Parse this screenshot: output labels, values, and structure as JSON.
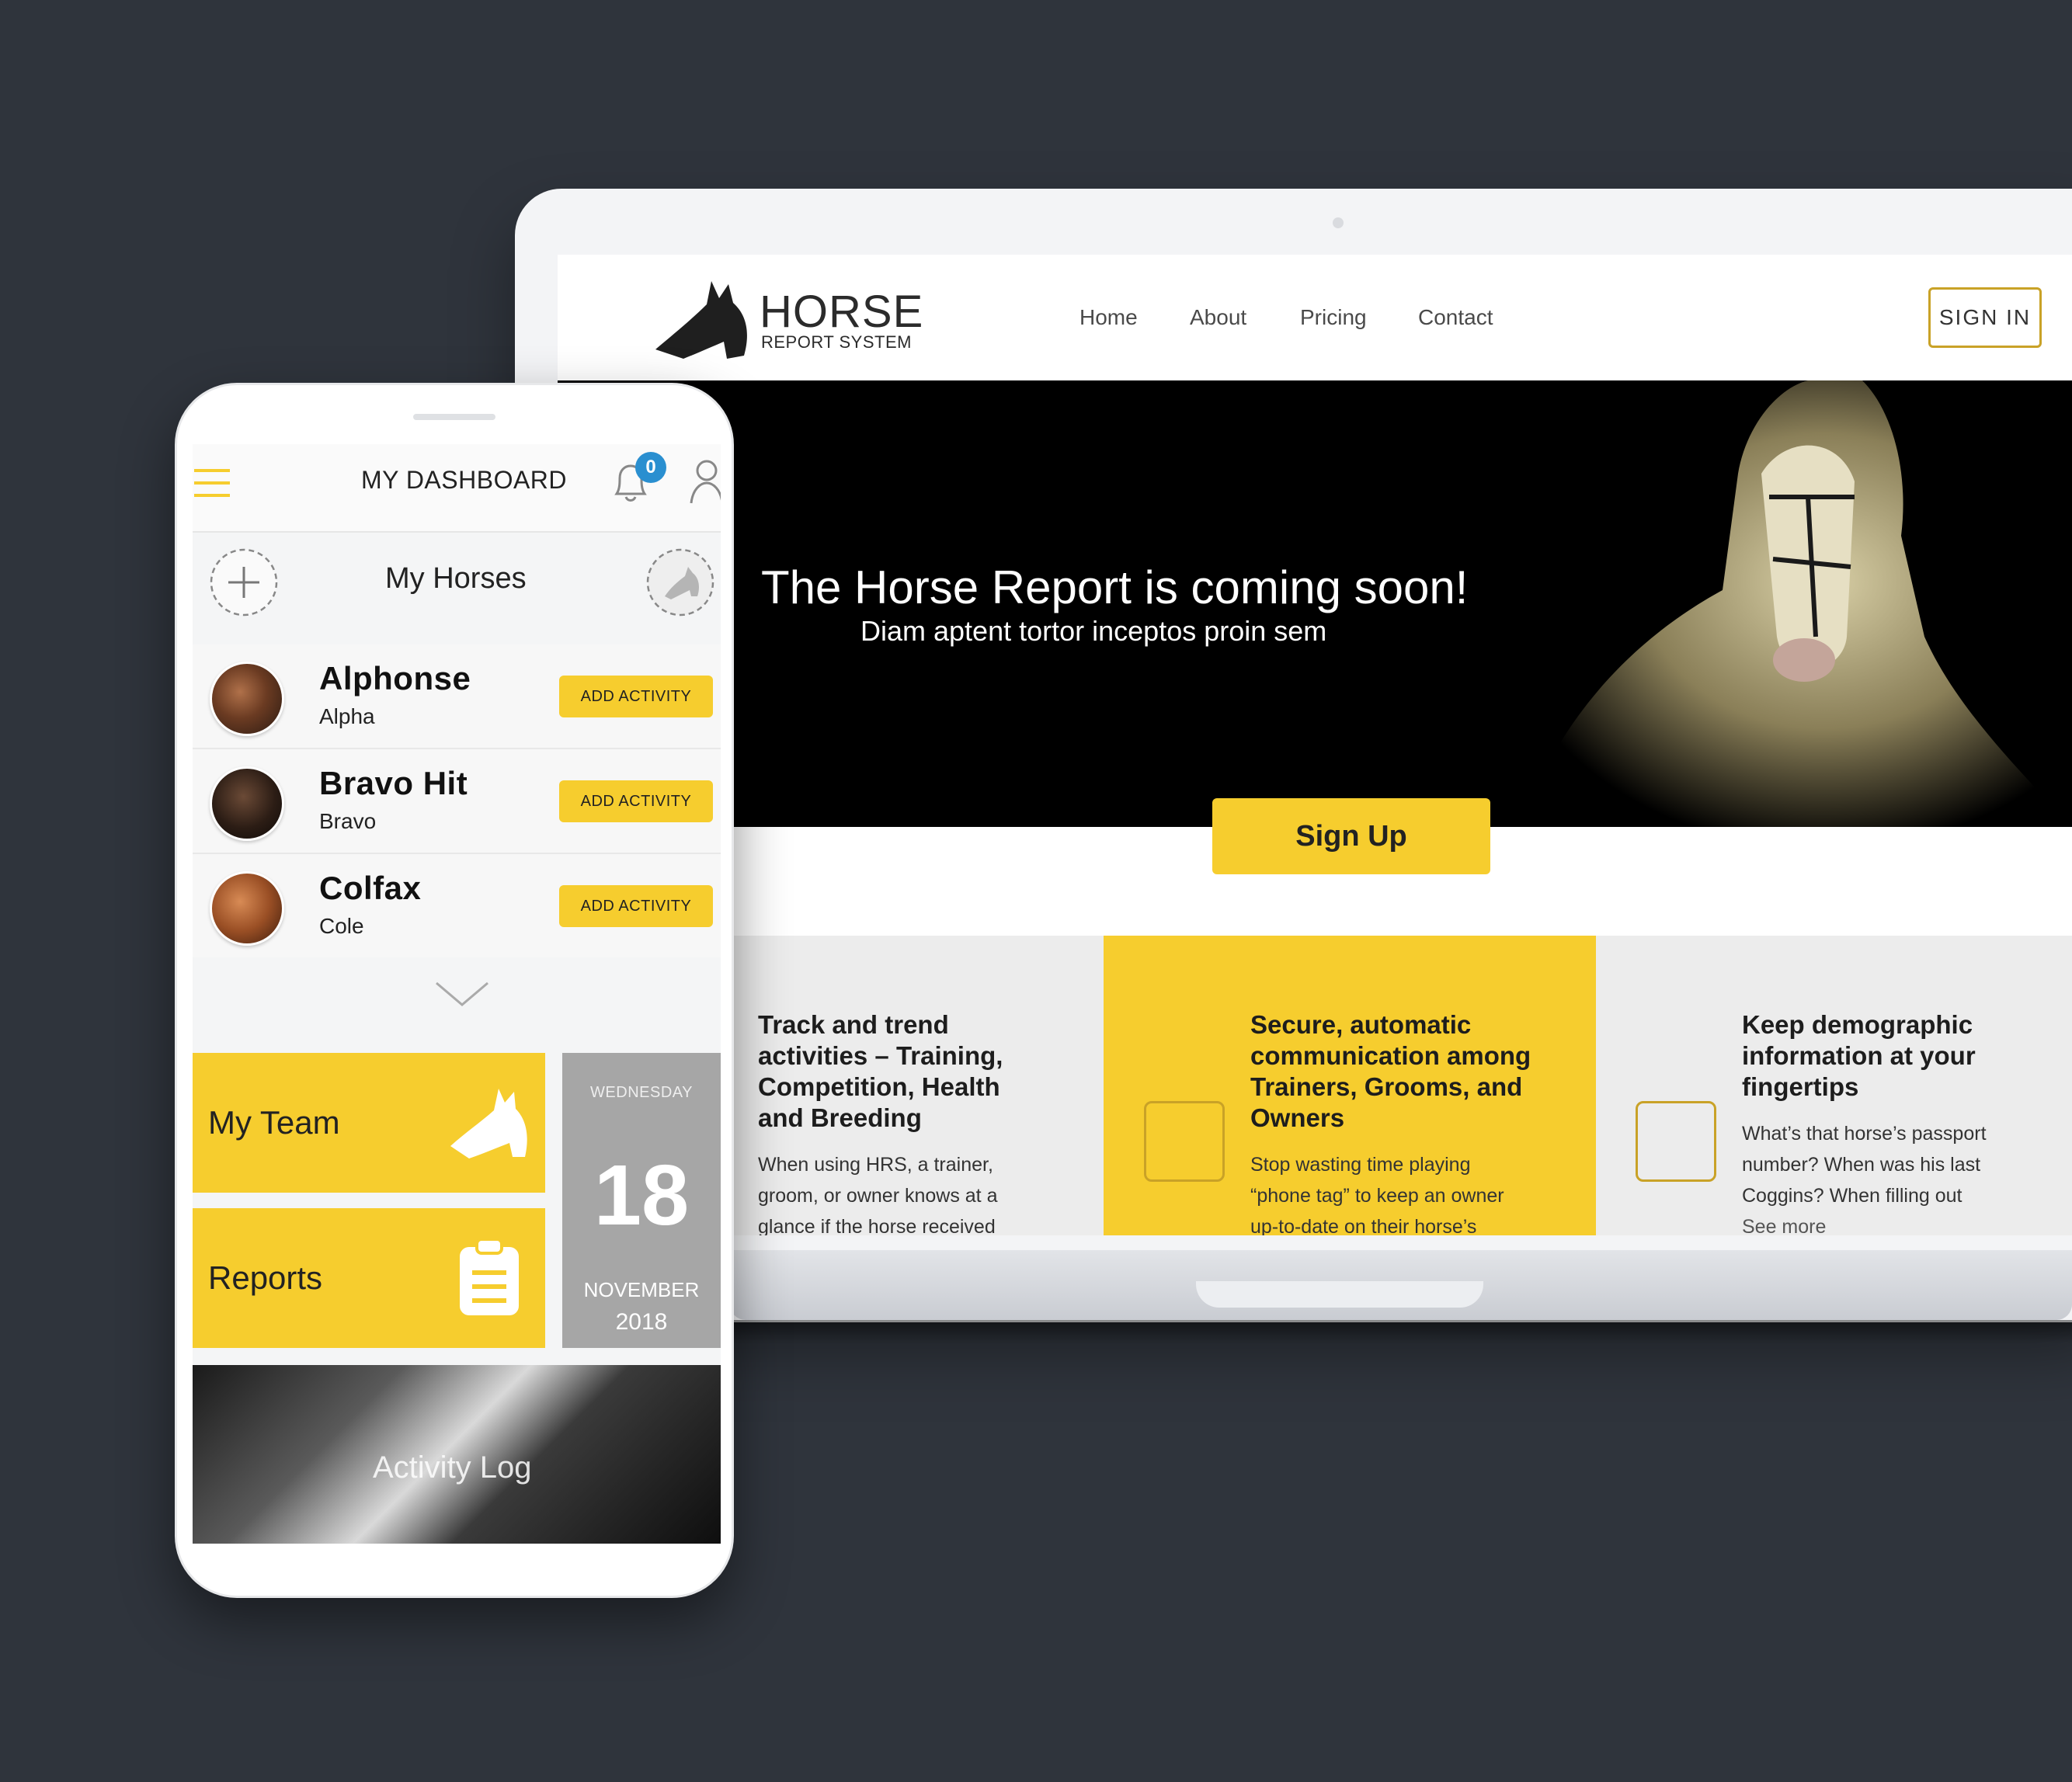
{
  "colors": {
    "background": "#2f343c",
    "accent": "#f6cd2e",
    "gold_outline": "#c9a227",
    "badge": "#2a8fd0",
    "date_tile": "#a6a6a6"
  },
  "website": {
    "logo": {
      "word": "HORSE",
      "sub": "REPORT SYSTEM",
      "icon": "horse-head-logo-icon"
    },
    "nav": [
      "Home",
      "About",
      "Pricing",
      "Contact"
    ],
    "signin_label": "SIGN IN",
    "hero": {
      "title": "The Horse Report is coming soon!",
      "subtitle": "Diam aptent tortor inceptos proin sem",
      "cta_label": "Sign Up"
    },
    "features": [
      {
        "title_lines": [
          "Track and trend",
          "activities – Training,",
          "Competition, Health",
          "and Breeding"
        ],
        "body_lines": [
          "When using HRS, a trainer,",
          "groom, or owner knows at a",
          "glance if the horse received"
        ]
      },
      {
        "title_lines": [
          "Secure, automatic",
          "communication among",
          "Trainers, Grooms, and",
          "Owners"
        ],
        "body_lines": [
          "Stop wasting time playing",
          "“phone tag” to keep an owner",
          "up-to-date on their horse’s"
        ]
      },
      {
        "title_lines": [
          "Keep demographic",
          "information at your",
          "fingertips"
        ],
        "body_lines": [
          "What’s that horse’s passport",
          "number? When was his last",
          "Coggins? When filling out"
        ],
        "see_more": "See more"
      }
    ]
  },
  "app": {
    "header": {
      "title": "MY DASHBOARD",
      "notification_count": "0",
      "menu_icon": "hamburger-icon",
      "bell_icon": "bell-icon",
      "user_icon": "user-icon"
    },
    "my_horses": {
      "title": "My Horses",
      "add_icon": "plus-icon",
      "horses": [
        {
          "name": "Alphonse",
          "nickname": "Alpha",
          "button": "ADD ACTIVITY"
        },
        {
          "name": "Bravo Hit",
          "nickname": "Bravo",
          "button": "ADD ACTIVITY"
        },
        {
          "name": "Colfax",
          "nickname": "Cole",
          "button": "ADD ACTIVITY"
        }
      ],
      "expand_icon": "chevron-down-icon"
    },
    "tiles": {
      "team": {
        "label": "My Team",
        "icon": "horse-head-icon"
      },
      "reports": {
        "label": "Reports",
        "icon": "clipboard-icon"
      },
      "date": {
        "weekday": "WEDNESDAY",
        "day": "18",
        "month": "NOVEMBER",
        "year": "2018"
      },
      "activity_log": {
        "label": "Activity Log"
      }
    }
  }
}
